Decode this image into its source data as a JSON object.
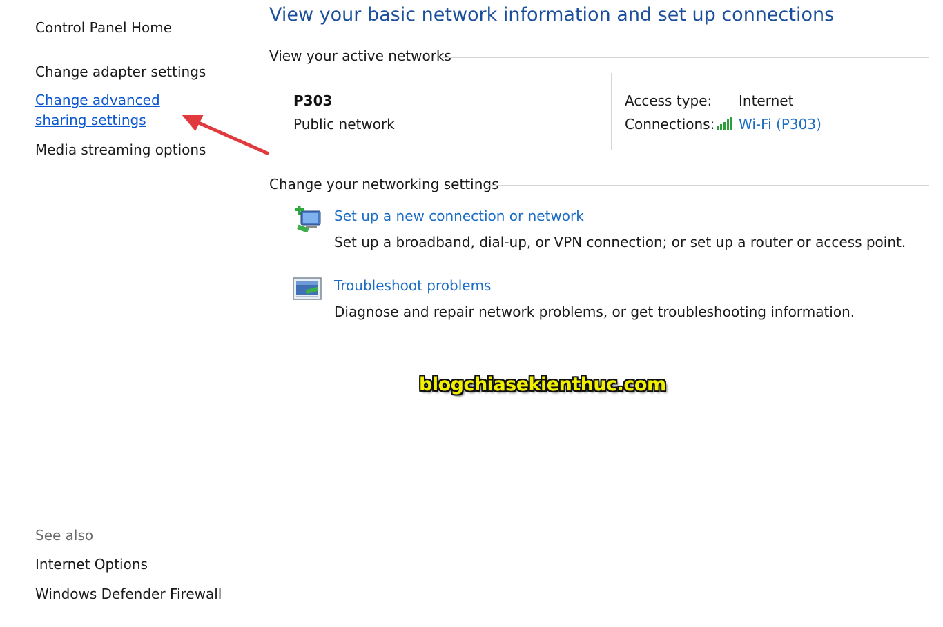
{
  "sidebar": {
    "home_label": "Control Panel Home",
    "items": [
      {
        "label": "Change adapter settings"
      },
      {
        "label": "Change advanced sharing settings"
      },
      {
        "label": "Media streaming options"
      }
    ],
    "see_also": {
      "heading": "See also",
      "items": [
        {
          "label": "Internet Options"
        },
        {
          "label": "Windows Defender Firewall"
        }
      ]
    }
  },
  "main": {
    "title": "View your basic network information and set up connections",
    "active_networks": {
      "heading": "View your active networks",
      "network_name": "P303",
      "network_type": "Public network",
      "access_type_label": "Access type:",
      "access_type_value": "Internet",
      "connections_label": "Connections:",
      "connection_link": "Wi-Fi (P303)"
    },
    "change_settings": {
      "heading": "Change your networking settings",
      "tasks": [
        {
          "link": "Set up a new connection or network",
          "description": "Set up a broadband, dial-up, or VPN connection; or set up a router or access point."
        },
        {
          "link": "Troubleshoot problems",
          "description": "Diagnose and repair network problems, or get troubleshooting information."
        }
      ]
    }
  },
  "watermark": "blogchiasekienthuc.com",
  "colors": {
    "title_blue": "#1b4f9c",
    "link_blue": "#1a6cc4",
    "annotation_arrow": "#e0393e",
    "signal_green": "#2e9e3a",
    "watermark_yellow": "#f1f000"
  }
}
